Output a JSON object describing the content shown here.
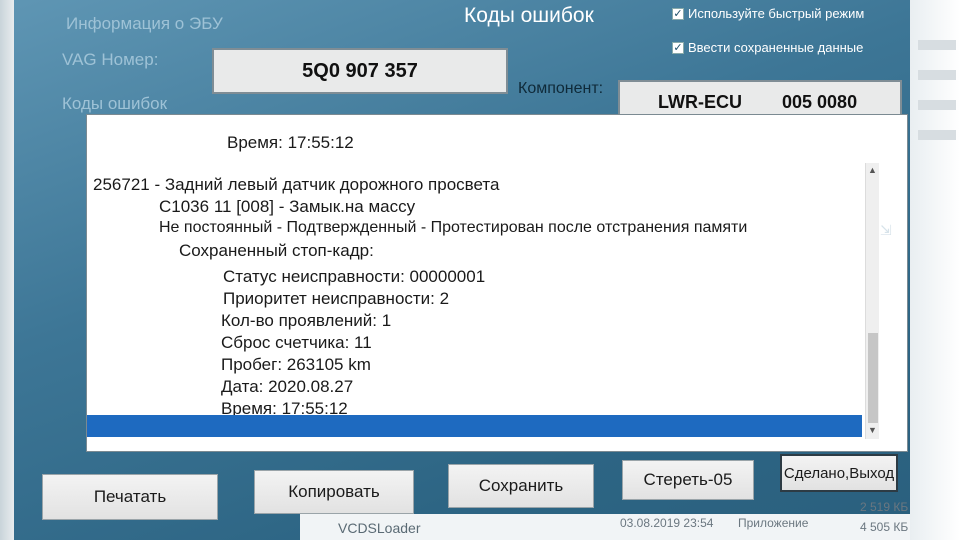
{
  "header": {
    "ecu_info_label": "Информация о ЭБУ",
    "title": "Коды ошибок",
    "vag_label": "VAG Номер:",
    "vag_value": "5Q0 907 357",
    "component_label": "Компонент:",
    "component_name": "LWR-ECU",
    "component_code": "005 0080",
    "codes_label": "Коды ошибок",
    "checkbox_fast": {
      "label": "Используйте быстрый режим",
      "checked": true
    },
    "checkbox_saved": {
      "label": "Ввести сохраненные данные",
      "checked": true
    }
  },
  "fault_list": {
    "lines": [
      "Время: 17:55:12",
      "256721 - Задний левый датчик дорожного просвета",
      "C1036 11 [008] - Замык.на массу",
      "Не постоянный - Подтвержденный - Протестирован после отстранения памяти",
      "Сохраненный стоп-кадр:",
      "Статус неисправности: 00000001",
      "Приоритет неисправности: 2",
      "Кол-во проявлений: 1",
      "Сброс счетчика: 11",
      "Пробег: 263105 km",
      "Дата: 2020.08.27",
      "Время: 17:55:12"
    ]
  },
  "buttons": {
    "print": "Печатать",
    "copy": "Копировать",
    "save": "Сохранить",
    "clear": "Стереть-05",
    "done": "Сделано,Выход"
  },
  "taskbar": {
    "app_name": "VCDSLoader",
    "date_1": "03.08.2019 23:54",
    "type_1": "Приложение",
    "size_1": "2 519 КБ",
    "size_2": "4 505 КБ"
  },
  "colors": {
    "window_bg": "#3d7696",
    "selection": "#1e6ac0",
    "list_bg": "#ffffff"
  }
}
